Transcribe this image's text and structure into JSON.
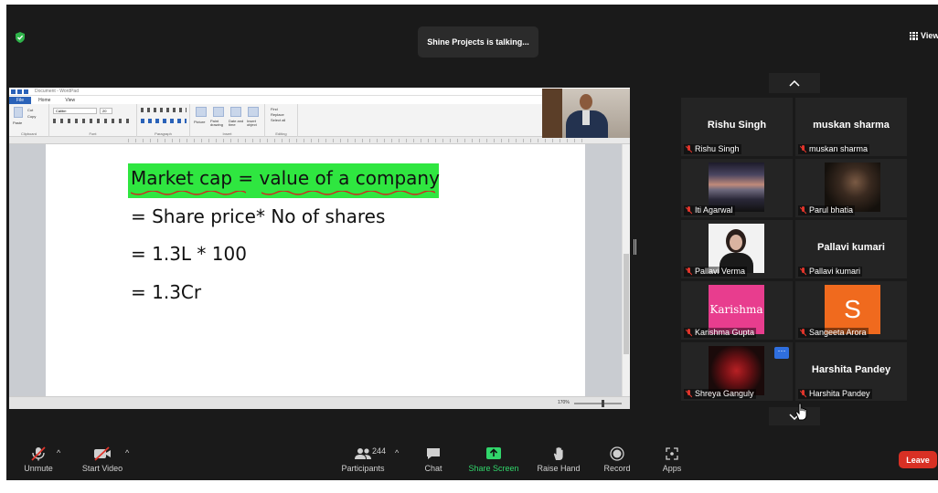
{
  "topbar": {
    "talking_indicator": "Shine Projects is talking...",
    "view_label": "View"
  },
  "shared_screen": {
    "window_title": "Document - WordPad",
    "ribbon_tabs": [
      "File",
      "Home",
      "View"
    ],
    "ribbon_groups": [
      "Clipboard",
      "Font",
      "Paragraph",
      "Insert",
      "Editing"
    ],
    "ribbon": {
      "paste": "Paste",
      "cut": "Cut",
      "copy": "Copy",
      "font_name": "Calibri",
      "font_size": "20",
      "picture": "Picture",
      "paint_drawing": "Paint drawing",
      "date_and_time": "Date and time",
      "insert_object": "Insert object",
      "find": "Find",
      "replace": "Replace",
      "select_all": "Select all"
    },
    "document_lines": [
      "Market cap = value of a company",
      "= Share price* No of shares",
      "= 1.3L * 100",
      "= 1.3Cr"
    ],
    "zoom": "170%",
    "highlight_color": "#2fe640"
  },
  "participants": [
    {
      "name": "Rishu Singh",
      "label": "Rishu Singh",
      "video": "none"
    },
    {
      "name": "muskan sharma",
      "label": "muskan sharma",
      "video": "none"
    },
    {
      "name": "Iti Agarwal",
      "video": "photo"
    },
    {
      "name": "Parul bhatia",
      "video": "photo"
    },
    {
      "name": "Pallavi Verma",
      "video": "photo"
    },
    {
      "name": "Pallavi kumari",
      "label": "Pallavi kumari",
      "video": "none"
    },
    {
      "name": "Karishma Gupta",
      "avatar_text": "Karishma",
      "video": "photo"
    },
    {
      "name": "Sangeeta Arora",
      "avatar_letter": "S",
      "avatar_color": "#f06a1e",
      "video": "avatar"
    },
    {
      "name": "Shreya Ganguly",
      "video": "photo"
    },
    {
      "name": "Harshita Pandey",
      "label": "Harshita Pandey",
      "video": "none"
    }
  ],
  "toolbar": {
    "unmute": "Unmute",
    "start_video": "Start Video",
    "participants": "Participants",
    "participant_count": "244",
    "chat": "Chat",
    "share_screen": "Share Screen",
    "raise_hand": "Raise Hand",
    "record": "Record",
    "apps": "Apps",
    "leave": "Leave"
  },
  "colors": {
    "leave": "#d83024",
    "share_screen": "#31d66b",
    "muted_mic": "#e0352b"
  }
}
